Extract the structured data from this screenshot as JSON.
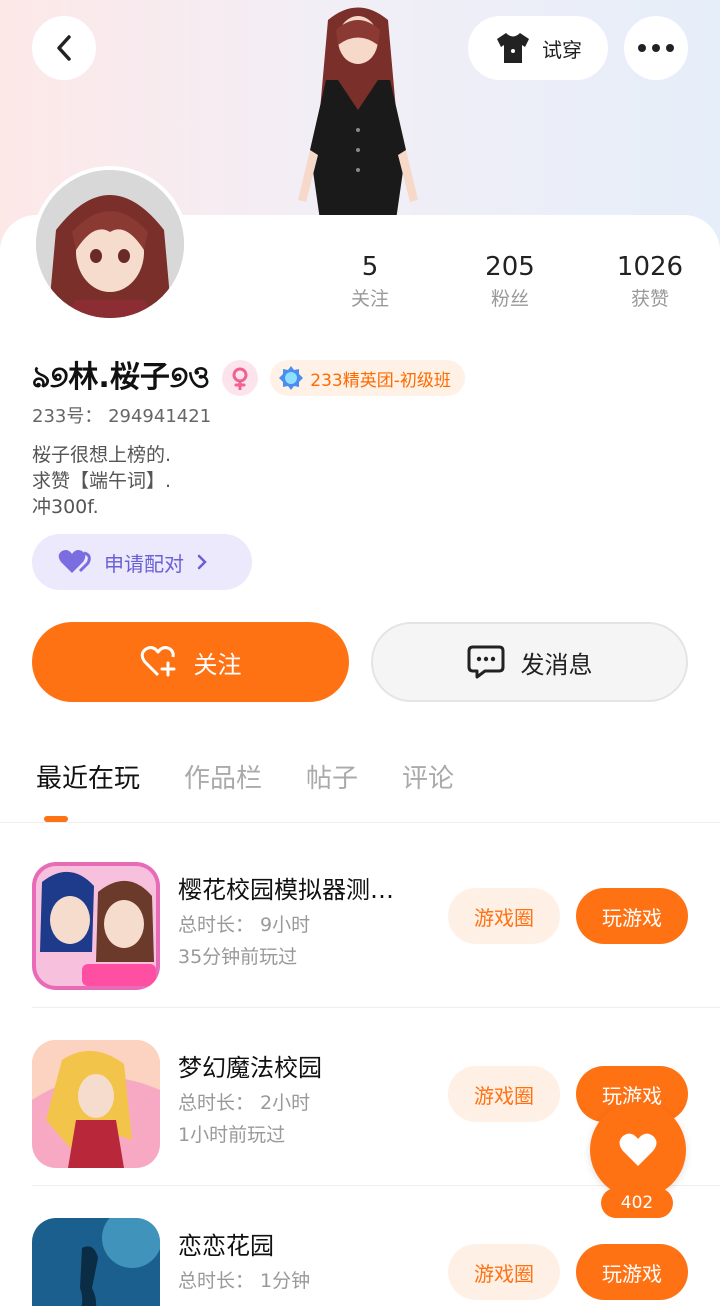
{
  "header": {
    "try_on_label": "试穿"
  },
  "stats": [
    {
      "count": "5",
      "label": "关注"
    },
    {
      "count": "205",
      "label": "粉丝"
    },
    {
      "count": "1026",
      "label": "获赞"
    }
  ],
  "profile": {
    "nickname": "ঌ୭林.桜子୭ও",
    "club_badge": "233精英团-初级班",
    "uid": "233号：  294941421",
    "bio_lines": [
      "桜子很想上榜的.",
      "求赞【端午词】.",
      "冲300f."
    ],
    "pair_label": "申请配对"
  },
  "actions": {
    "follow_label": "关注",
    "message_label": "发消息"
  },
  "tabs": [
    "最近在玩",
    "作品栏",
    "帖子",
    "评论"
  ],
  "games": [
    {
      "title": "樱花校园模拟器测…",
      "duration": "总时长：  9小时",
      "last_played": "35分钟前玩过",
      "circle_label": "游戏圈",
      "play_label": "玩游戏"
    },
    {
      "title": "梦幻魔法校园",
      "duration": "总时长：  2小时",
      "last_played": "1小时前玩过",
      "circle_label": "游戏圈",
      "play_label": "玩游戏"
    },
    {
      "title": "恋恋花园",
      "duration": "总时长：  1分钟",
      "last_played": "",
      "circle_label": "游戏圈",
      "play_label": "玩游戏"
    }
  ],
  "like_fab": {
    "count": "402"
  },
  "colors": {
    "accent": "#ff7214",
    "pair": "#6a5fd6",
    "badge_text": "#ff6a00"
  }
}
